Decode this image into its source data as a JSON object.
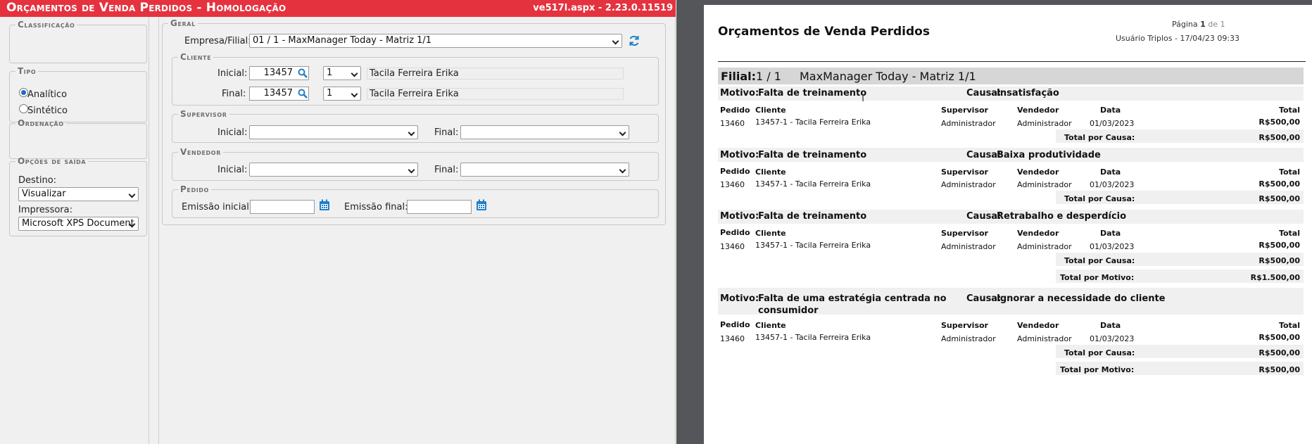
{
  "window": {
    "title": "Orçamentos de Venda Perdidos - Homologação",
    "version": "ve517l.aspx - 2.23.0.11519"
  },
  "sidebar": {
    "classificacao": {
      "legend": "Classificação"
    },
    "tipo": {
      "legend": "Tipo",
      "options": [
        {
          "label": "Analítico",
          "checked": true
        },
        {
          "label": "Sintético",
          "checked": false
        }
      ]
    },
    "ordenacao": {
      "legend": "Ordenação"
    },
    "opcoes": {
      "legend": "Opções de saída",
      "destino_label": "Destino:",
      "destino_value": "Visualizar",
      "impressora_label": "Impressora:",
      "impressora_value": "Microsoft XPS Document"
    }
  },
  "form": {
    "geral": {
      "legend": "Geral",
      "empresa_label": "Empresa/Filial:",
      "empresa_value": "01 / 1 - MaxManager Today - Matriz 1/1"
    },
    "cliente": {
      "legend": "Cliente",
      "inicial_label": "Inicial:",
      "inicial_code": "13457",
      "inicial_seq": "1",
      "inicial_name": "Tacila Ferreira Erika",
      "final_label": "Final:",
      "final_code": "13457",
      "final_seq": "1",
      "final_name": "Tacila Ferreira Erika"
    },
    "supervisor": {
      "legend": "Supervisor",
      "inicial_label": "Inicial:",
      "final_label": "Final:"
    },
    "vendedor": {
      "legend": "Vendedor",
      "inicial_label": "Inicial:",
      "final_label": "Final:"
    },
    "pedido": {
      "legend": "Pedido",
      "emissao_inicial_label": "Emissão inicial:",
      "emissao_final_label": "Emissão final:"
    }
  },
  "report": {
    "title": "Orçamentos de Venda Perdidos",
    "page_word": "Página",
    "page_num": "1",
    "page_of": "de 1",
    "user_line": "Usuário Triplos - 17/04/23 09:33",
    "filial_label": "Filial:",
    "filial_code": "1 / 1",
    "filial_name": "MaxManager Today - Matriz 1/1",
    "motivo_label": "Motivo:",
    "causa_label": "Causa:",
    "columns": [
      "Pedido",
      "Cliente",
      "Supervisor",
      "Vendedor",
      "Data",
      "Total"
    ],
    "total_causa_label": "Total por Causa:",
    "total_motivo_label": "Total por Motivo:",
    "groups": [
      {
        "motivo": "Falta de treinamento",
        "causa": "Insatisfação",
        "row": [
          "13460",
          "13457-1 - Tacila Ferreira Erika",
          "Administrador",
          "Administrador",
          "01/03/2023",
          "R$500,00"
        ],
        "total_causa": "R$500,00"
      },
      {
        "motivo": "Falta de treinamento",
        "causa": "Baixa produtividade",
        "row": [
          "13460",
          "13457-1 - Tacila Ferreira Erika",
          "Administrador",
          "Administrador",
          "01/03/2023",
          "R$500,00"
        ],
        "total_causa": "R$500,00"
      },
      {
        "motivo": "Falta de treinamento",
        "causa": "Retrabalho e desperdício",
        "row": [
          "13460",
          "13457-1 - Tacila Ferreira Erika",
          "Administrador",
          "Administrador",
          "01/03/2023",
          "R$500,00"
        ],
        "total_causa": "R$500,00",
        "total_motivo": "R$1.500,00"
      },
      {
        "motivo_line1": "Falta de uma estratégia centrada no",
        "motivo_line2": "consumidor",
        "causa": "Ignorar a necessidade do cliente",
        "row": [
          "13460",
          "13457-1 - Tacila Ferreira Erika",
          "Administrador",
          "Administrador",
          "01/03/2023",
          "R$500,00"
        ],
        "total_causa": "R$500,00",
        "total_motivo": "R$500,00"
      }
    ]
  }
}
